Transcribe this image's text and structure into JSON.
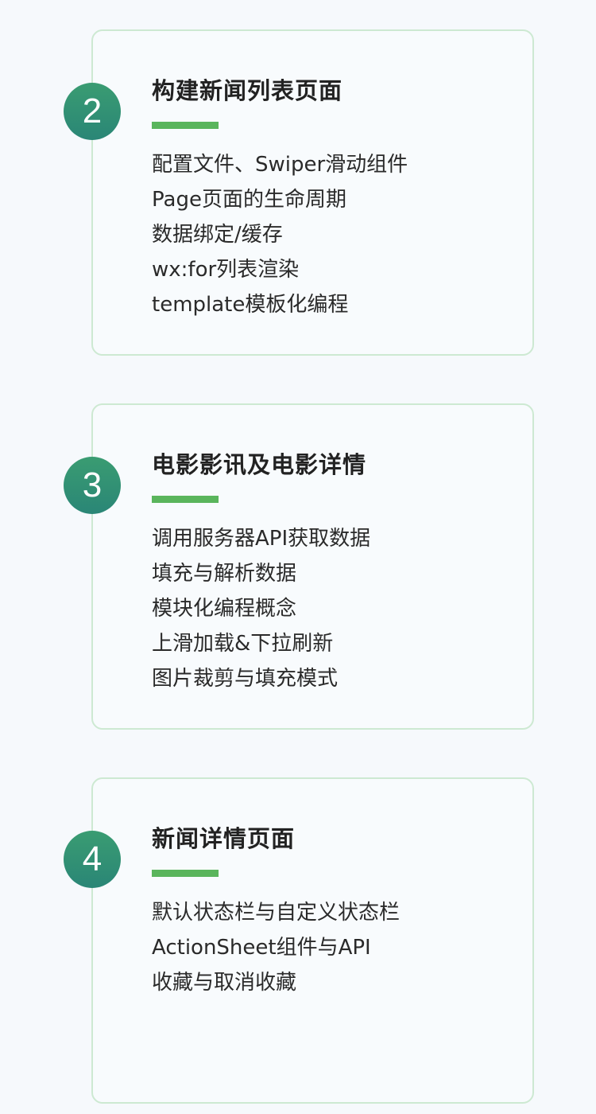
{
  "sections": [
    {
      "number": "2",
      "title": "构建新闻列表页面",
      "items": [
        "配置文件、Swiper滑动组件",
        "Page页面的生命周期",
        "数据绑定/缓存",
        "wx:for列表渲染",
        "template模板化编程"
      ]
    },
    {
      "number": "3",
      "title": "电影影讯及电影详情",
      "items": [
        "调用服务器API获取数据",
        "填充与解析数据",
        "模块化编程概念",
        "上滑加载&下拉刷新",
        "图片裁剪与填充模式"
      ]
    },
    {
      "number": "4",
      "title": "新闻详情页面",
      "items": [
        "默认状态栏与自定义状态栏",
        "ActionSheet组件与API",
        "收藏与取消收藏"
      ]
    }
  ],
  "colors": {
    "badge": "#2f8f73",
    "accent_bar": "#5ab55c",
    "card_border": "#cde9d2",
    "background": "#f6f9fc"
  }
}
